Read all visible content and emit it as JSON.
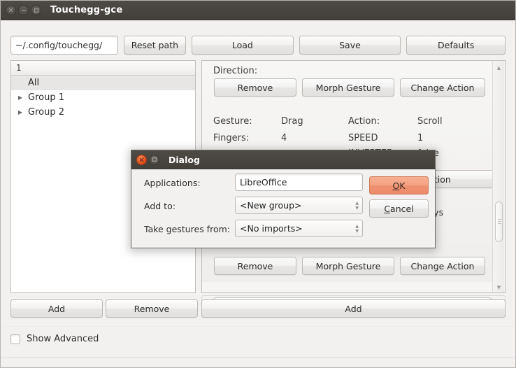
{
  "window": {
    "title": "Touchegg-gce",
    "controls": [
      {
        "name": "close-button",
        "glyph": "✕"
      },
      {
        "name": "minimize-button",
        "glyph": "–"
      },
      {
        "name": "maximize-button",
        "glyph": "□"
      }
    ]
  },
  "toolbar": {
    "path_value": "~/.config/touchegg/",
    "path_placeholder": "~/.config/touchegg/",
    "reset_path_label": "Reset path",
    "load_label": "Load",
    "save_label": "Save",
    "defaults_label": "Defaults"
  },
  "tree": {
    "column_header": "1",
    "rows": [
      {
        "label": "All",
        "expandable": false,
        "selected": true
      },
      {
        "label": "Group 1",
        "expandable": true,
        "selected": false
      },
      {
        "label": "Group 2",
        "expandable": true,
        "selected": false
      }
    ]
  },
  "detail": {
    "direction_label": "Direction:",
    "group1_buttons": {
      "remove": "Remove",
      "morph": "Morph Gesture",
      "change": "Change Action"
    },
    "fields": {
      "gesture_key": "Gesture:",
      "gesture_value": "Drag",
      "fingers_key": "Fingers:",
      "fingers_value": "4",
      "action_key": "Action:",
      "action_value": "Scroll",
      "speed_key": "SPEED",
      "speed_value": "1",
      "inverted_key": "INVERTED:",
      "inverted_value": "false"
    },
    "obscured_buttons": {
      "change_action_partial": "e Action",
      "record_keys_partial": "d Keys"
    },
    "group2_buttons": {
      "remove": "Remove",
      "morph": "Morph Gesture",
      "change": "Change Action"
    }
  },
  "bottom": {
    "add_left_label": "Add",
    "remove_left_label": "Remove",
    "add_right_label": "Add",
    "show_advanced_label": "Show Advanced",
    "show_advanced_checked": false
  },
  "dialog": {
    "title": "Dialog",
    "controls": [
      {
        "name": "close-button",
        "glyph": "✕"
      },
      {
        "name": "maximize-button",
        "glyph": "□"
      }
    ],
    "applications_label": "Applications:",
    "applications_value": "LibreOffice",
    "applications_placeholder": "LibreOffice",
    "add_to_label": "Add to:",
    "add_to_value": "<New group>",
    "take_gestures_label": "Take gestures from:",
    "take_gestures_value": "<No imports>",
    "ok_label": "OK",
    "ok_mnemonic": "O",
    "ok_rest": "K",
    "cancel_label": "Cancel",
    "cancel_mnemonic": "C",
    "cancel_rest": "ancel"
  },
  "colors": {
    "titlebar": "#45423e",
    "accent_orange": "#dd4814",
    "ok_button": "#ef9272",
    "window_bg": "#f2f1f0",
    "selection": "#e8e6e4"
  }
}
